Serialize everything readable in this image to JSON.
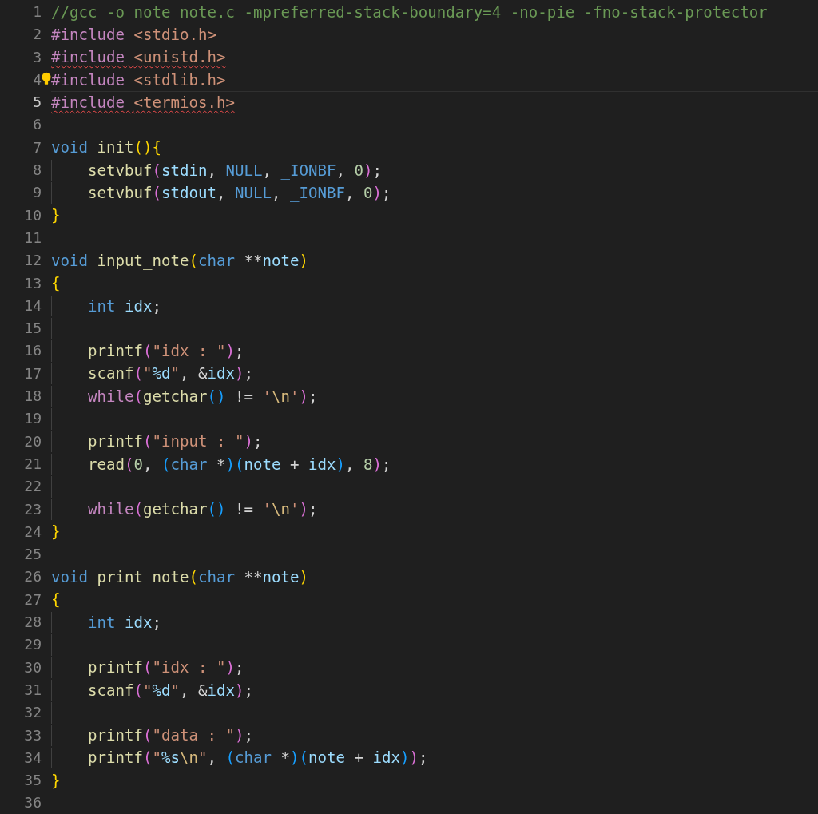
{
  "lines": [
    {
      "number": "1",
      "tokens": [
        {
          "text": "//gcc -o note note.c -mpreferred-stack-boundary=4 -no-pie -fno-stack-protector",
          "kind": "comment"
        }
      ]
    },
    {
      "number": "2",
      "tokens": [
        {
          "text": "#include ",
          "kind": "preproc"
        },
        {
          "text": "<stdio.h>",
          "kind": "string"
        }
      ]
    },
    {
      "number": "3",
      "squiggle": true,
      "tokens": [
        {
          "text": "#include ",
          "kind": "preproc"
        },
        {
          "text": "<unistd.h>",
          "kind": "string"
        }
      ]
    },
    {
      "number": "4",
      "lightbulb": true,
      "tokens": [
        {
          "text": "#include ",
          "kind": "preproc"
        },
        {
          "text": "<stdlib.h>",
          "kind": "string"
        }
      ]
    },
    {
      "number": "5",
      "current": true,
      "squiggle": true,
      "tokens": [
        {
          "text": "#include ",
          "kind": "preproc"
        },
        {
          "text": "<termios.h>",
          "kind": "string"
        }
      ]
    },
    {
      "number": "6"
    },
    {
      "number": "7",
      "tokens": [
        {
          "text": "void ",
          "kind": "keyword"
        },
        {
          "text": "init",
          "kind": "function"
        },
        {
          "text": "(){",
          "kind": "bracket1"
        }
      ]
    },
    {
      "number": "8",
      "indented": true,
      "tokens": [
        {
          "text": "setvbuf",
          "kind": "function"
        },
        {
          "text": "(",
          "kind": "bracket2"
        },
        {
          "text": "stdin",
          "kind": "variable"
        },
        {
          "text": ", ",
          "kind": "operator"
        },
        {
          "text": "NULL",
          "kind": "macro"
        },
        {
          "text": ", ",
          "kind": "operator"
        },
        {
          "text": "_IONBF",
          "kind": "macro"
        },
        {
          "text": ", ",
          "kind": "operator"
        },
        {
          "text": "0",
          "kind": "number"
        },
        {
          "text": ")",
          "kind": "bracket2"
        },
        {
          "text": ";",
          "kind": "operator"
        }
      ]
    },
    {
      "number": "9",
      "indented": true,
      "tokens": [
        {
          "text": "setvbuf",
          "kind": "function"
        },
        {
          "text": "(",
          "kind": "bracket2"
        },
        {
          "text": "stdout",
          "kind": "variable"
        },
        {
          "text": ", ",
          "kind": "operator"
        },
        {
          "text": "NULL",
          "kind": "macro"
        },
        {
          "text": ", ",
          "kind": "operator"
        },
        {
          "text": "_IONBF",
          "kind": "macro"
        },
        {
          "text": ", ",
          "kind": "operator"
        },
        {
          "text": "0",
          "kind": "number"
        },
        {
          "text": ")",
          "kind": "bracket2"
        },
        {
          "text": ";",
          "kind": "operator"
        }
      ]
    },
    {
      "number": "10",
      "tokens": [
        {
          "text": "}",
          "kind": "bracket1"
        }
      ]
    },
    {
      "number": "11"
    },
    {
      "number": "12",
      "tokens": [
        {
          "text": "void ",
          "kind": "keyword"
        },
        {
          "text": "input_note",
          "kind": "function"
        },
        {
          "text": "(",
          "kind": "bracket1"
        },
        {
          "text": "char ",
          "kind": "keyword"
        },
        {
          "text": "**",
          "kind": "operator"
        },
        {
          "text": "note",
          "kind": "variable"
        },
        {
          "text": ")",
          "kind": "bracket1"
        }
      ]
    },
    {
      "number": "13",
      "tokens": [
        {
          "text": "{",
          "kind": "bracket1"
        }
      ]
    },
    {
      "number": "14",
      "indented": true,
      "tokens": [
        {
          "text": "int ",
          "kind": "keyword"
        },
        {
          "text": "idx",
          "kind": "variable"
        },
        {
          "text": ";",
          "kind": "operator"
        }
      ]
    },
    {
      "number": "15",
      "indented": true
    },
    {
      "number": "16",
      "indented": true,
      "tokens": [
        {
          "text": "printf",
          "kind": "function"
        },
        {
          "text": "(",
          "kind": "bracket2"
        },
        {
          "text": "\"idx : \"",
          "kind": "string"
        },
        {
          "text": ")",
          "kind": "bracket2"
        },
        {
          "text": ";",
          "kind": "operator"
        }
      ]
    },
    {
      "number": "17",
      "indented": true,
      "tokens": [
        {
          "text": "scanf",
          "kind": "function"
        },
        {
          "text": "(",
          "kind": "bracket2"
        },
        {
          "text": "\"",
          "kind": "string"
        },
        {
          "text": "%d",
          "kind": "format"
        },
        {
          "text": "\"",
          "kind": "string"
        },
        {
          "text": ", &",
          "kind": "operator"
        },
        {
          "text": "idx",
          "kind": "variable"
        },
        {
          "text": ")",
          "kind": "bracket2"
        },
        {
          "text": ";",
          "kind": "operator"
        }
      ]
    },
    {
      "number": "18",
      "indented": true,
      "tokens": [
        {
          "text": "while",
          "kind": "preproc"
        },
        {
          "text": "(",
          "kind": "bracket2"
        },
        {
          "text": "getchar",
          "kind": "function"
        },
        {
          "text": "()",
          "kind": "bracket3"
        },
        {
          "text": " != ",
          "kind": "operator"
        },
        {
          "text": "'",
          "kind": "string"
        },
        {
          "text": "\\n",
          "kind": "escape"
        },
        {
          "text": "'",
          "kind": "string"
        },
        {
          "text": ")",
          "kind": "bracket2"
        },
        {
          "text": ";",
          "kind": "operator"
        }
      ]
    },
    {
      "number": "19",
      "indented": true
    },
    {
      "number": "20",
      "indented": true,
      "tokens": [
        {
          "text": "printf",
          "kind": "function"
        },
        {
          "text": "(",
          "kind": "bracket2"
        },
        {
          "text": "\"input : \"",
          "kind": "string"
        },
        {
          "text": ")",
          "kind": "bracket2"
        },
        {
          "text": ";",
          "kind": "operator"
        }
      ]
    },
    {
      "number": "21",
      "indented": true,
      "tokens": [
        {
          "text": "read",
          "kind": "function"
        },
        {
          "text": "(",
          "kind": "bracket2"
        },
        {
          "text": "0",
          "kind": "number"
        },
        {
          "text": ", ",
          "kind": "operator"
        },
        {
          "text": "(",
          "kind": "bracket3"
        },
        {
          "text": "char ",
          "kind": "keyword"
        },
        {
          "text": "*",
          "kind": "operator"
        },
        {
          "text": ")(",
          "kind": "bracket3"
        },
        {
          "text": "note",
          "kind": "variable"
        },
        {
          "text": " + ",
          "kind": "operator"
        },
        {
          "text": "idx",
          "kind": "variable"
        },
        {
          "text": ")",
          "kind": "bracket3"
        },
        {
          "text": ", ",
          "kind": "operator"
        },
        {
          "text": "8",
          "kind": "number"
        },
        {
          "text": ")",
          "kind": "bracket2"
        },
        {
          "text": ";",
          "kind": "operator"
        }
      ]
    },
    {
      "number": "22",
      "indented": true
    },
    {
      "number": "23",
      "indented": true,
      "tokens": [
        {
          "text": "while",
          "kind": "preproc"
        },
        {
          "text": "(",
          "kind": "bracket2"
        },
        {
          "text": "getchar",
          "kind": "function"
        },
        {
          "text": "()",
          "kind": "bracket3"
        },
        {
          "text": " != ",
          "kind": "operator"
        },
        {
          "text": "'",
          "kind": "string"
        },
        {
          "text": "\\n",
          "kind": "escape"
        },
        {
          "text": "'",
          "kind": "string"
        },
        {
          "text": ")",
          "kind": "bracket2"
        },
        {
          "text": ";",
          "kind": "operator"
        }
      ]
    },
    {
      "number": "24",
      "tokens": [
        {
          "text": "}",
          "kind": "bracket1"
        }
      ]
    },
    {
      "number": "25"
    },
    {
      "number": "26",
      "tokens": [
        {
          "text": "void ",
          "kind": "keyword"
        },
        {
          "text": "print_note",
          "kind": "function"
        },
        {
          "text": "(",
          "kind": "bracket1"
        },
        {
          "text": "char ",
          "kind": "keyword"
        },
        {
          "text": "**",
          "kind": "operator"
        },
        {
          "text": "note",
          "kind": "variable"
        },
        {
          "text": ")",
          "kind": "bracket1"
        }
      ]
    },
    {
      "number": "27",
      "tokens": [
        {
          "text": "{",
          "kind": "bracket1"
        }
      ]
    },
    {
      "number": "28",
      "indented": true,
      "tokens": [
        {
          "text": "int ",
          "kind": "keyword"
        },
        {
          "text": "idx",
          "kind": "variable"
        },
        {
          "text": ";",
          "kind": "operator"
        }
      ]
    },
    {
      "number": "29",
      "indented": true
    },
    {
      "number": "30",
      "indented": true,
      "tokens": [
        {
          "text": "printf",
          "kind": "function"
        },
        {
          "text": "(",
          "kind": "bracket2"
        },
        {
          "text": "\"idx : \"",
          "kind": "string"
        },
        {
          "text": ")",
          "kind": "bracket2"
        },
        {
          "text": ";",
          "kind": "operator"
        }
      ]
    },
    {
      "number": "31",
      "indented": true,
      "tokens": [
        {
          "text": "scanf",
          "kind": "function"
        },
        {
          "text": "(",
          "kind": "bracket2"
        },
        {
          "text": "\"",
          "kind": "string"
        },
        {
          "text": "%d",
          "kind": "format"
        },
        {
          "text": "\"",
          "kind": "string"
        },
        {
          "text": ", &",
          "kind": "operator"
        },
        {
          "text": "idx",
          "kind": "variable"
        },
        {
          "text": ")",
          "kind": "bracket2"
        },
        {
          "text": ";",
          "kind": "operator"
        }
      ]
    },
    {
      "number": "32",
      "indented": true
    },
    {
      "number": "33",
      "indented": true,
      "tokens": [
        {
          "text": "printf",
          "kind": "function"
        },
        {
          "text": "(",
          "kind": "bracket2"
        },
        {
          "text": "\"data : \"",
          "kind": "string"
        },
        {
          "text": ")",
          "kind": "bracket2"
        },
        {
          "text": ";",
          "kind": "operator"
        }
      ]
    },
    {
      "number": "34",
      "indented": true,
      "tokens": [
        {
          "text": "printf",
          "kind": "function"
        },
        {
          "text": "(",
          "kind": "bracket2"
        },
        {
          "text": "\"",
          "kind": "string"
        },
        {
          "text": "%s",
          "kind": "format"
        },
        {
          "text": "\\n",
          "kind": "escape"
        },
        {
          "text": "\"",
          "kind": "string"
        },
        {
          "text": ", ",
          "kind": "operator"
        },
        {
          "text": "(",
          "kind": "bracket3"
        },
        {
          "text": "char ",
          "kind": "keyword"
        },
        {
          "text": "*",
          "kind": "operator"
        },
        {
          "text": ")(",
          "kind": "bracket3"
        },
        {
          "text": "note",
          "kind": "variable"
        },
        {
          "text": " + ",
          "kind": "operator"
        },
        {
          "text": "idx",
          "kind": "variable"
        },
        {
          "text": ")",
          "kind": "bracket3"
        },
        {
          "text": ")",
          "kind": "bracket2"
        },
        {
          "text": ";",
          "kind": "operator"
        }
      ]
    },
    {
      "number": "35",
      "tokens": [
        {
          "text": "}",
          "kind": "bracket1"
        }
      ]
    },
    {
      "number": "36"
    }
  ]
}
